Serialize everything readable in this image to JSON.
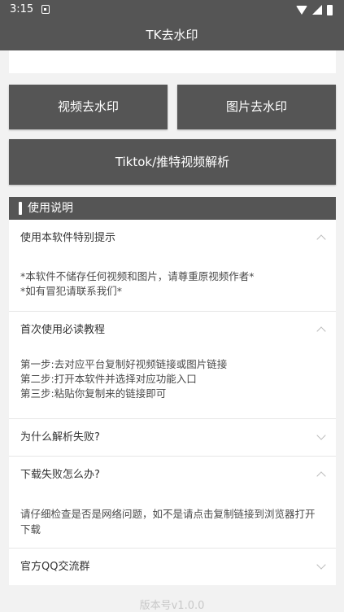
{
  "status_bar": {
    "time": "3:15"
  },
  "app_bar": {
    "title": "TK去水印"
  },
  "buttons": {
    "video": "视频去水印",
    "image": "图片去水印",
    "tiktok": "Tiktok/推特视频解析"
  },
  "section": {
    "title": "使用说明"
  },
  "items": [
    {
      "title": "使用本软件特别提示",
      "expanded": true,
      "lines": [
        "*本软件不储存任何视频和图片，请尊重原视频作者*",
        "*如有冒犯请联系我们*"
      ]
    },
    {
      "title": "首次使用必读教程",
      "expanded": true,
      "lines": [
        "第一步:去对应平台复制好视频链接或图片链接",
        "第二步:打开本软件并选择对应功能入口",
        "第三步:粘贴你复制来的链接即可"
      ]
    },
    {
      "title": "为什么解析失败?",
      "expanded": false,
      "lines": []
    },
    {
      "title": "下载失败怎么办?",
      "expanded": true,
      "lines": [
        "请仔细检查是否是网络问题，如不是请点击复制链接到浏览器打开下载"
      ]
    },
    {
      "title": "官方QQ交流群",
      "expanded": false,
      "lines": []
    }
  ],
  "footer": {
    "version": "版本号v1.0.0"
  },
  "colors": {
    "primary": "#555555",
    "background": "#f2f2f2",
    "card": "#ffffff"
  },
  "icons": [
    "notification-icon",
    "wifi-icon",
    "signal-icon",
    "battery-icon",
    "chevron-up-icon",
    "chevron-down-icon"
  ]
}
